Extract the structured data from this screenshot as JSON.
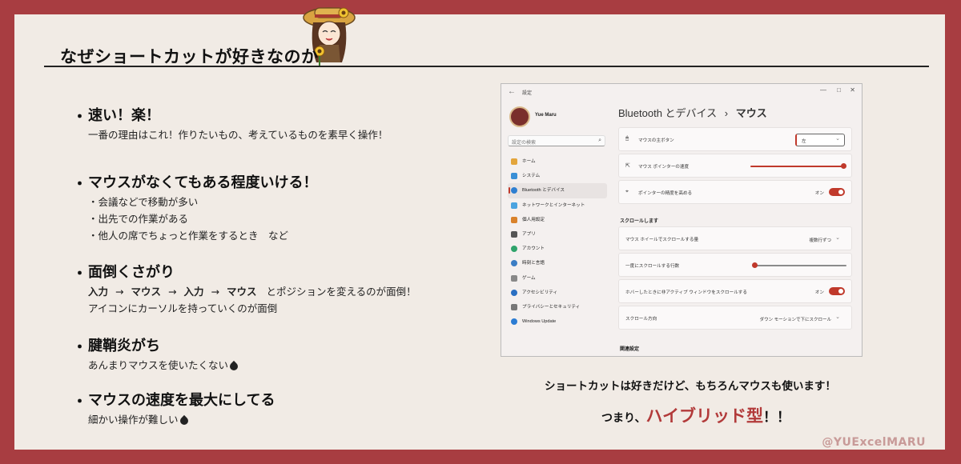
{
  "header": {
    "title": "なぜショートカットが好きなのか"
  },
  "points": [
    {
      "heading": "速い！楽！",
      "lines": [
        "一番の理由はこれ！作りたいもの、考えているものを素早く操作！"
      ]
    },
    {
      "heading": "マウスがなくてもある程度いける！",
      "lines": [
        "・会議などで移動が多い",
        "・出先での作業がある",
        "・他人の席でちょっと作業をするとき　など"
      ]
    },
    {
      "heading": "面倒くさがり",
      "flow": [
        "入力",
        "→",
        "マウス",
        "→",
        "入力",
        "→",
        "マウス"
      ],
      "flow_tail": "とポジションを変えるのが面倒！",
      "lines": [
        "アイコンにカーソルを持っていくのが面倒"
      ]
    },
    {
      "heading": "腱鞘炎がち",
      "lines": [
        "あんまりマウスを使いたくない"
      ]
    },
    {
      "heading": "マウスの速度を最大にしてる",
      "lines": [
        "細かい操作が難しい"
      ]
    }
  ],
  "settings": {
    "window_title": "設定",
    "back": "←",
    "controls": [
      "—",
      "□",
      "✕"
    ],
    "user_name": "Yue Maru",
    "search_placeholder": "設定の検索",
    "nav": [
      "ホーム",
      "システム",
      "Bluetooth とデバイス",
      "ネットワークとインターネット",
      "個人用設定",
      "アプリ",
      "アカウント",
      "時刻と言語",
      "ゲーム",
      "アクセシビリティ",
      "プライバシーとセキュリティ",
      "Windows Update"
    ],
    "breadcrumb_parent": "Bluetooth とデバイス",
    "breadcrumb_sep": "›",
    "breadcrumb_current": "マウス",
    "primary_button_label": "マウスの主ボタン",
    "primary_button_value": "左",
    "pointer_speed_label": "マウス ポインターの速度",
    "pointer_speed_level": 0.97,
    "precision_label": "ポインターの精度を高める",
    "precision_state": "オン",
    "scroll_section": "スクロールします",
    "wheel_label": "マウス ホイールでスクロールする量",
    "wheel_value": "複数行ずつ",
    "lines_label": "一度にスクロールする行数",
    "lines_level": 0.0,
    "inactive_label": "ホバーしたときに非アクティブ ウィンドウをスクロールする",
    "inactive_state": "オン",
    "direction_label": "スクロール方向",
    "direction_value": "ダウン モーションで下にスクロール",
    "related_section": "関連設定"
  },
  "notes": {
    "line1": "ショートカットは好きだけど、もちろんマウスも使います！",
    "line2_pre": "つまり、",
    "line2_emphasis": "ハイブリッド型",
    "line2_post": "！！"
  },
  "credit": "@YUExcelMARU",
  "colors": {
    "frame": "#a83d41",
    "background": "#f1ebe5",
    "accent": "#b23a3a",
    "windows_accent": "#c0392b"
  }
}
